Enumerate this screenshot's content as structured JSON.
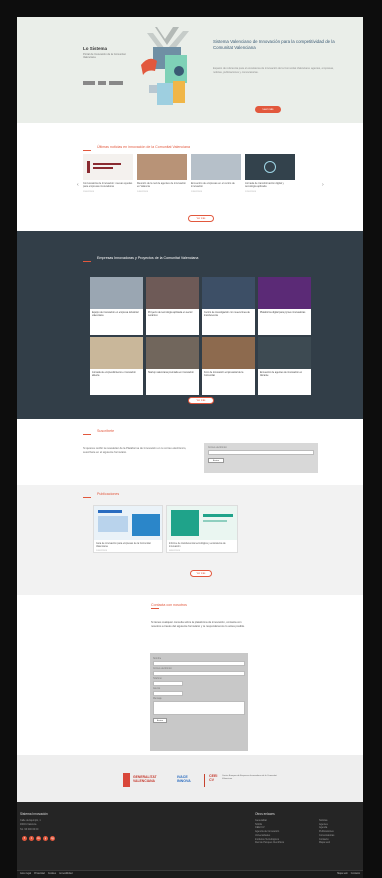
{
  "hero": {
    "brand_title": "Lo Sistema",
    "brand_subtitle": "Portal de Innovación de la Comunitat Valenciana",
    "logos": [
      "GVA",
      "IVACE",
      "CEEI"
    ],
    "title": "Sistema Valenciano de Innovación para la competitividad de la Comunitat Valenciana",
    "text": "Espacio de referencia para el ecosistema de innovación de la Comunitat Valenciana: agentes, empresas, noticias, publicaciones y convocatorias.",
    "button": "Leer más",
    "colors": {
      "accent": "#e2583d",
      "hero_bg": "#eaeee9",
      "title": "#3a5a74"
    }
  },
  "news": {
    "title": "Últimas noticias en innovación de la Comunitat Valenciana",
    "items": [
      {
        "text": "Convocatoria de Innovación: nuevas ayudas para empresas innovadoras",
        "date": "15/02/2024",
        "color": "#8a2b31"
      },
      {
        "text": "Reunión de la red de agentes de innovación en València",
        "date": "14/02/2024",
        "color": "#b89377"
      },
      {
        "text": "Encuentro de empresas en el centro de innovación",
        "date": "13/02/2024",
        "color": "#b6c0c9"
      },
      {
        "text": "Jornada de transformación digital y tecnología aplicada",
        "date": "12/02/2024",
        "color": "#33424c"
      }
    ],
    "button": "Ver más"
  },
  "agents": {
    "title": "Empresas Innovadoras y Proyectos de la Comunitat Valenciana",
    "items": [
      {
        "text": "Equipo de innovación en empresa industrial valenciana",
        "color": "#9aa6b2"
      },
      {
        "text": "Proyecto de tecnología aplicada en sector cerámico",
        "color": "#6e5a57"
      },
      {
        "text": "Centro de investigación con nueva línea de transferencia",
        "color": "#3d4f66"
      },
      {
        "text": "Plataforma digital para pymes innovadoras",
        "color": "#5b2a76"
      },
      {
        "text": "Jornada de emprendimiento e innovación abierta",
        "color": "#c9b79a"
      },
      {
        "text": "Startup valenciana premiada en innovación",
        "color": "#71665c"
      },
      {
        "text": "Foro de innovación empresarial de la Comunitat",
        "color": "#8d6a4e"
      },
      {
        "text": "Encuentro de agentes de innovación en Alicante",
        "color": "#3d4a52"
      }
    ],
    "button": "Ver más"
  },
  "agenda": {
    "title": "Suscríbete",
    "text": "Si quieres recibir la newsletter de la Plataforma de Innovación en tu correo electrónico, suscríbete en el siguiente formulario.",
    "field_label": "Correo electrónico",
    "button": "Enviar"
  },
  "publications": {
    "title": "Publicaciones",
    "items": [
      {
        "text": "Guía de innovación para empresas de la Comunitat Valenciana",
        "date": "10/02/2024"
      },
      {
        "text": "Informe de transferencia tecnológica y ecosistema de innovación",
        "date": "08/02/2024"
      }
    ],
    "button": "Ver más"
  },
  "contact": {
    "title": "Contacta con nosotros",
    "text": "Si tienes cualquier consulta sobre la plataforma de innovación, contacta con nosotros a través del siguiente formulario y te responderemos lo antes posible.",
    "fields": [
      "Nombre",
      "Correo electrónico",
      "Teléfono",
      "Asunto",
      "Mensaje"
    ],
    "button": "Enviar"
  },
  "privacy": "Política de privacidad y aviso legal",
  "footer_logos": {
    "gva": "GENERALITAT VALENCIANA",
    "ivace": "IVACE INNOVA",
    "ceei_badge": "CEEI CV",
    "ceei_desc": "Centro Europeo de Empresas Innovadoras de la Comunitat Valenciana"
  },
  "footer": {
    "col1_title": "Sistema Innovación",
    "col1_items": [
      "Calle de Ejemplo, 1",
      "46001 València",
      "Tel. 96 000 00 00"
    ],
    "social": [
      "f",
      "t",
      "in",
      "y",
      "ig"
    ],
    "col2_title": "Otros enlaces",
    "col2_items": [
      "Generalitat",
      "IVACE",
      "CEEI CV",
      "Agencia de Innovación",
      "Universidades",
      "Institutos Tecnológicos",
      "Red de Parques Científicos"
    ],
    "col3_items": [
      "Noticias",
      "Agentes",
      "Agenda",
      "Publicaciones",
      "Convocatorias",
      "Contacto",
      "Mapa web"
    ],
    "bottom_left": [
      "Aviso legal",
      "Privacidad",
      "Cookies",
      "Accesibilidad"
    ],
    "bottom_right": [
      "Mapa web",
      "Contacto"
    ]
  }
}
